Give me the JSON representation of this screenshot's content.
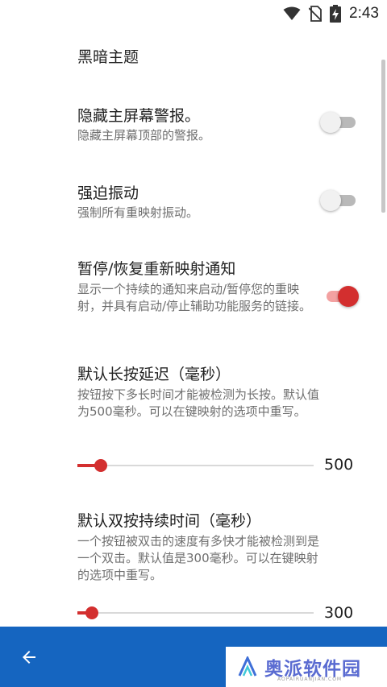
{
  "status_bar": {
    "time": "2:43",
    "icons": [
      "wifi-icon",
      "no-sim-icon",
      "battery-charging-icon"
    ]
  },
  "prefs": {
    "dark_theme": {
      "title": "黑暗主题"
    },
    "hide_home_alert": {
      "title": "隐藏主屏幕警报。",
      "summary": "隐藏主屏幕顶部的警报。",
      "enabled": false
    },
    "force_vibrate": {
      "title": "强迫振动",
      "summary": "强制所有重映射振动。",
      "enabled": false
    },
    "pause_resume_notification": {
      "title": "暂停/恢复重新映射通知",
      "summary": "显示一个持续的通知来启动/暂停您的重映射，并具有启动/停止辅助功能服务的链接。",
      "enabled": true
    },
    "long_press_delay": {
      "title": "默认长按延迟（毫秒）",
      "summary": "按钮按下多长时间才能被检测为长按。默认值为500毫秒。可以在键映射的选项中重写。",
      "value": "500",
      "fraction": 0.1
    },
    "double_press_duration": {
      "title": "默认双按持续时间（毫秒）",
      "summary": "一个按钮被双击的速度有多快才能被检测到是一个双击。默认值是300毫秒。可以在键映射的选项中重写。",
      "value": "300",
      "fraction": 0.06
    }
  },
  "bottom_bar": {
    "back_icon": "arrow-left-icon",
    "color": "#1565c0"
  },
  "watermark": {
    "text": "奥派软件园",
    "url": "AOPAIRUANJIAN.COM"
  },
  "colors": {
    "accent": "#d32f2f",
    "accent_light": "#f3a1a1"
  }
}
